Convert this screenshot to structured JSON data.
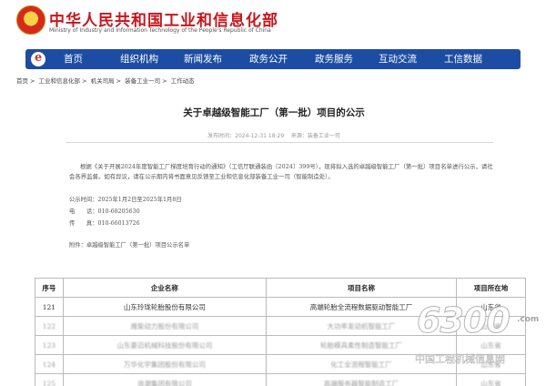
{
  "header": {
    "title": "中华人民共和国工业和信息化部",
    "subtitle": "Ministry of Industry and Information Technology of the People's Republic of China"
  },
  "nav": {
    "items": [
      "首页",
      "组织机构",
      "新闻发布",
      "政务公开",
      "政务服务",
      "互动交流",
      "工信数据"
    ]
  },
  "breadcrumb": [
    "首页",
    "工业和信息化部",
    "机关司局",
    "装备工业一司",
    "工作动态"
  ],
  "article": {
    "title": "关于卓越级智能工厂（第一批）项目的公示",
    "meta_date": "发布时间：2024-12-31 18:29",
    "meta_source": "来源：装备工业一司",
    "body": "根据《关于开展2024年度智能工厂梯度培育行动的通知》（工信厅联通装函〔2024〕399号），现将拟入选的卓越级智能工厂（第一批）项目名单进行公示，请社会各界监督。如有异议，请在公示期内将书面意见反馈至工业和信息化部装备工业一司（智能制造处）。",
    "period": "公示时间：2025年1月2日至2025年1月8日",
    "phone_label": "电　　话：",
    "phone": "010-68205630",
    "fax_label": "传　　真：",
    "fax": "010-66013726",
    "attachment": "附件：卓越级智能工厂（第一批）项目公示名单"
  },
  "table": {
    "headers": [
      "序号",
      "企业名称",
      "项目名称",
      "项目所在地"
    ],
    "rows": [
      [
        "121",
        "山东玲珑轮胎股份有限公司",
        "高端轮胎全流程数据驱动智能工厂",
        "山东省"
      ],
      [
        "122",
        "潍柴动力股份有限公司",
        "大功率发动机智能工厂",
        "山东省"
      ],
      [
        "123",
        "山东豪迈机械科技股份有限公司",
        "轮胎模具柔性制造智能工厂",
        "山东省"
      ],
      [
        "124",
        "万华化学集团股份有限公司",
        "化工全流程智能工厂",
        "山东省"
      ],
      [
        "125",
        "浪潮集团有限公司",
        "高端服务器智能制造工厂",
        "山东省"
      ]
    ]
  },
  "watermark": {
    "number": "6300",
    "dotcom": ".com",
    "text": "中国工程机械信息网"
  }
}
